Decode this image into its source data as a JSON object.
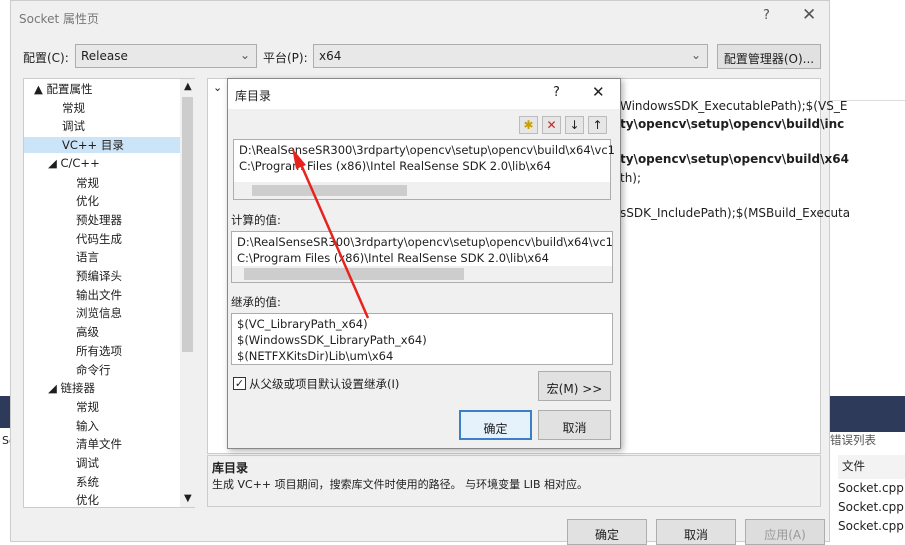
{
  "background": {
    "partial_left": "So",
    "error_list": "错误列表",
    "file_header": "文件",
    "files": [
      "Socket.cpp",
      "Socket.cpp",
      "Socket.cpp"
    ]
  },
  "main": {
    "title": "Socket 属性页",
    "help": "?",
    "close": "✕",
    "config_label": "配置(C):",
    "config_value": "Release",
    "platform_label": "平台(P):",
    "platform_value": "x64",
    "config_manager": "配置管理器(O)...",
    "tree": [
      {
        "t": "▲ 配置属性",
        "l": 0
      },
      {
        "t": "常规",
        "l": 2
      },
      {
        "t": "调试",
        "l": 2
      },
      {
        "t": "VC++ 目录",
        "l": 2,
        "sel": true
      },
      {
        "t": "◢ C/C++",
        "l": 1
      },
      {
        "t": "常规",
        "l": 3
      },
      {
        "t": "优化",
        "l": 3
      },
      {
        "t": "预处理器",
        "l": 3
      },
      {
        "t": "代码生成",
        "l": 3
      },
      {
        "t": "语言",
        "l": 3
      },
      {
        "t": "预编译头",
        "l": 3
      },
      {
        "t": "输出文件",
        "l": 3
      },
      {
        "t": "浏览信息",
        "l": 3
      },
      {
        "t": "高级",
        "l": 3
      },
      {
        "t": "所有选项",
        "l": 3
      },
      {
        "t": "命令行",
        "l": 3
      },
      {
        "t": "◢ 链接器",
        "l": 1
      },
      {
        "t": "常规",
        "l": 3
      },
      {
        "t": "输入",
        "l": 3
      },
      {
        "t": "清单文件",
        "l": 3
      },
      {
        "t": "调试",
        "l": 3
      },
      {
        "t": "系统",
        "l": 3
      },
      {
        "t": "优化",
        "l": 3
      }
    ],
    "right_lines": [
      "WindowsSDK_ExecutablePath);$(VS_E",
      "ty\\opencv\\setup\\opencv\\build\\inc",
      "ty\\opencv\\setup\\opencv\\build\\x64",
      "th);",
      "sSDK_IncludePath);$(MSBuild_Executa"
    ],
    "desc_title": "库目录",
    "desc_text": "生成 VC++ 项目期间，搜索库文件时使用的路径。 与环境变量 LIB 相对应。",
    "ok": "确定",
    "cancel": "取消",
    "apply": "应用(A)"
  },
  "dialog": {
    "title": "库目录",
    "help": "?",
    "close": "✕",
    "values": [
      "D:\\RealSenseSR300\\3rdparty\\opencv\\setup\\opencv\\build\\x64\\vc1",
      "C:\\Program Files (x86)\\Intel RealSense SDK 2.0\\lib\\x64"
    ],
    "computed_label": "计算的值:",
    "computed": [
      "D:\\RealSenseSR300\\3rdparty\\opencv\\setup\\opencv\\build\\x64\\vc1",
      "C:\\Program Files (x86)\\Intel RealSense SDK 2.0\\lib\\x64"
    ],
    "inherited_label": "继承的值:",
    "inherited": [
      "$(VC_LibraryPath_x64)",
      "$(WindowsSDK_LibraryPath_x64)",
      "$(NETFXKitsDir)Lib\\um\\x64"
    ],
    "inherit_checkbox": "从父级或项目默认设置继承(I)",
    "inherit_checked": true,
    "macros": "宏(M) >>",
    "ok": "确定",
    "cancel": "取消"
  },
  "annotation_color": "#e8231e"
}
